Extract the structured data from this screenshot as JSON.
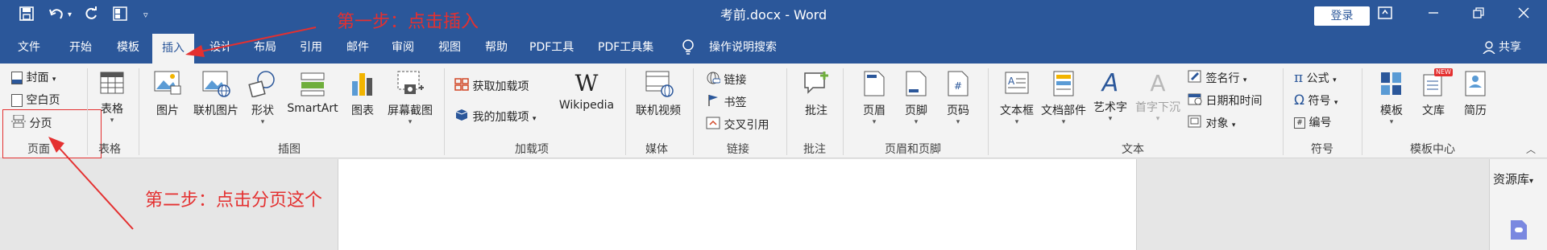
{
  "title_bar": {
    "document_title": "考前.docx - Word",
    "login_label": "登录"
  },
  "tabs": [
    "文件",
    "开始",
    "模板",
    "插入",
    "设计",
    "布局",
    "引用",
    "邮件",
    "审阅",
    "视图",
    "帮助",
    "PDF工具",
    "PDF工具集"
  ],
  "search_label": "操作说明搜索",
  "share_label": "共享",
  "ribbon": {
    "pages": {
      "cover": "封面",
      "blank": "空白页",
      "break": "分页",
      "group": "页面"
    },
    "tables": {
      "table": "表格",
      "group": "表格"
    },
    "illustrations": {
      "picture": "图片",
      "online_picture": "联机图片",
      "shapes": "形状",
      "smartart": "SmartArt",
      "chart": "图表",
      "screenshot": "屏幕截图",
      "group": "插图"
    },
    "addins": {
      "get": "获取加载项",
      "mine": "我的加载项",
      "wikipedia": "Wikipedia",
      "group": "加载项"
    },
    "media": {
      "online_video": "联机视频",
      "group": "媒体"
    },
    "links": {
      "link": "链接",
      "bookmark": "书签",
      "cross_ref": "交叉引用",
      "group": "链接"
    },
    "comments": {
      "comment": "批注",
      "group": "批注"
    },
    "header_footer": {
      "header": "页眉",
      "footer": "页脚",
      "page_number": "页码",
      "group": "页眉和页脚"
    },
    "text": {
      "textbox": "文本框",
      "quick_parts": "文档部件",
      "wordart": "艺术字",
      "dropcap": "首字下沉",
      "signature": "签名行",
      "datetime": "日期和时间",
      "object": "对象",
      "group": "文本"
    },
    "symbols": {
      "equation": "公式",
      "symbol": "符号",
      "numbering": "编号",
      "group": "符号"
    },
    "templates": {
      "template": "模板",
      "library": "文库",
      "resume": "简历",
      "group": "模板中心",
      "new_badge": "NEW"
    }
  },
  "resource_panel": {
    "label": "资源库"
  },
  "annotations": {
    "step1": "第一步：点击插入",
    "step2": "第二步：点击分页这个"
  },
  "colors": {
    "brand": "#2b579a",
    "annotation": "#e43030",
    "ribbon_bg": "#f3f3f3"
  }
}
